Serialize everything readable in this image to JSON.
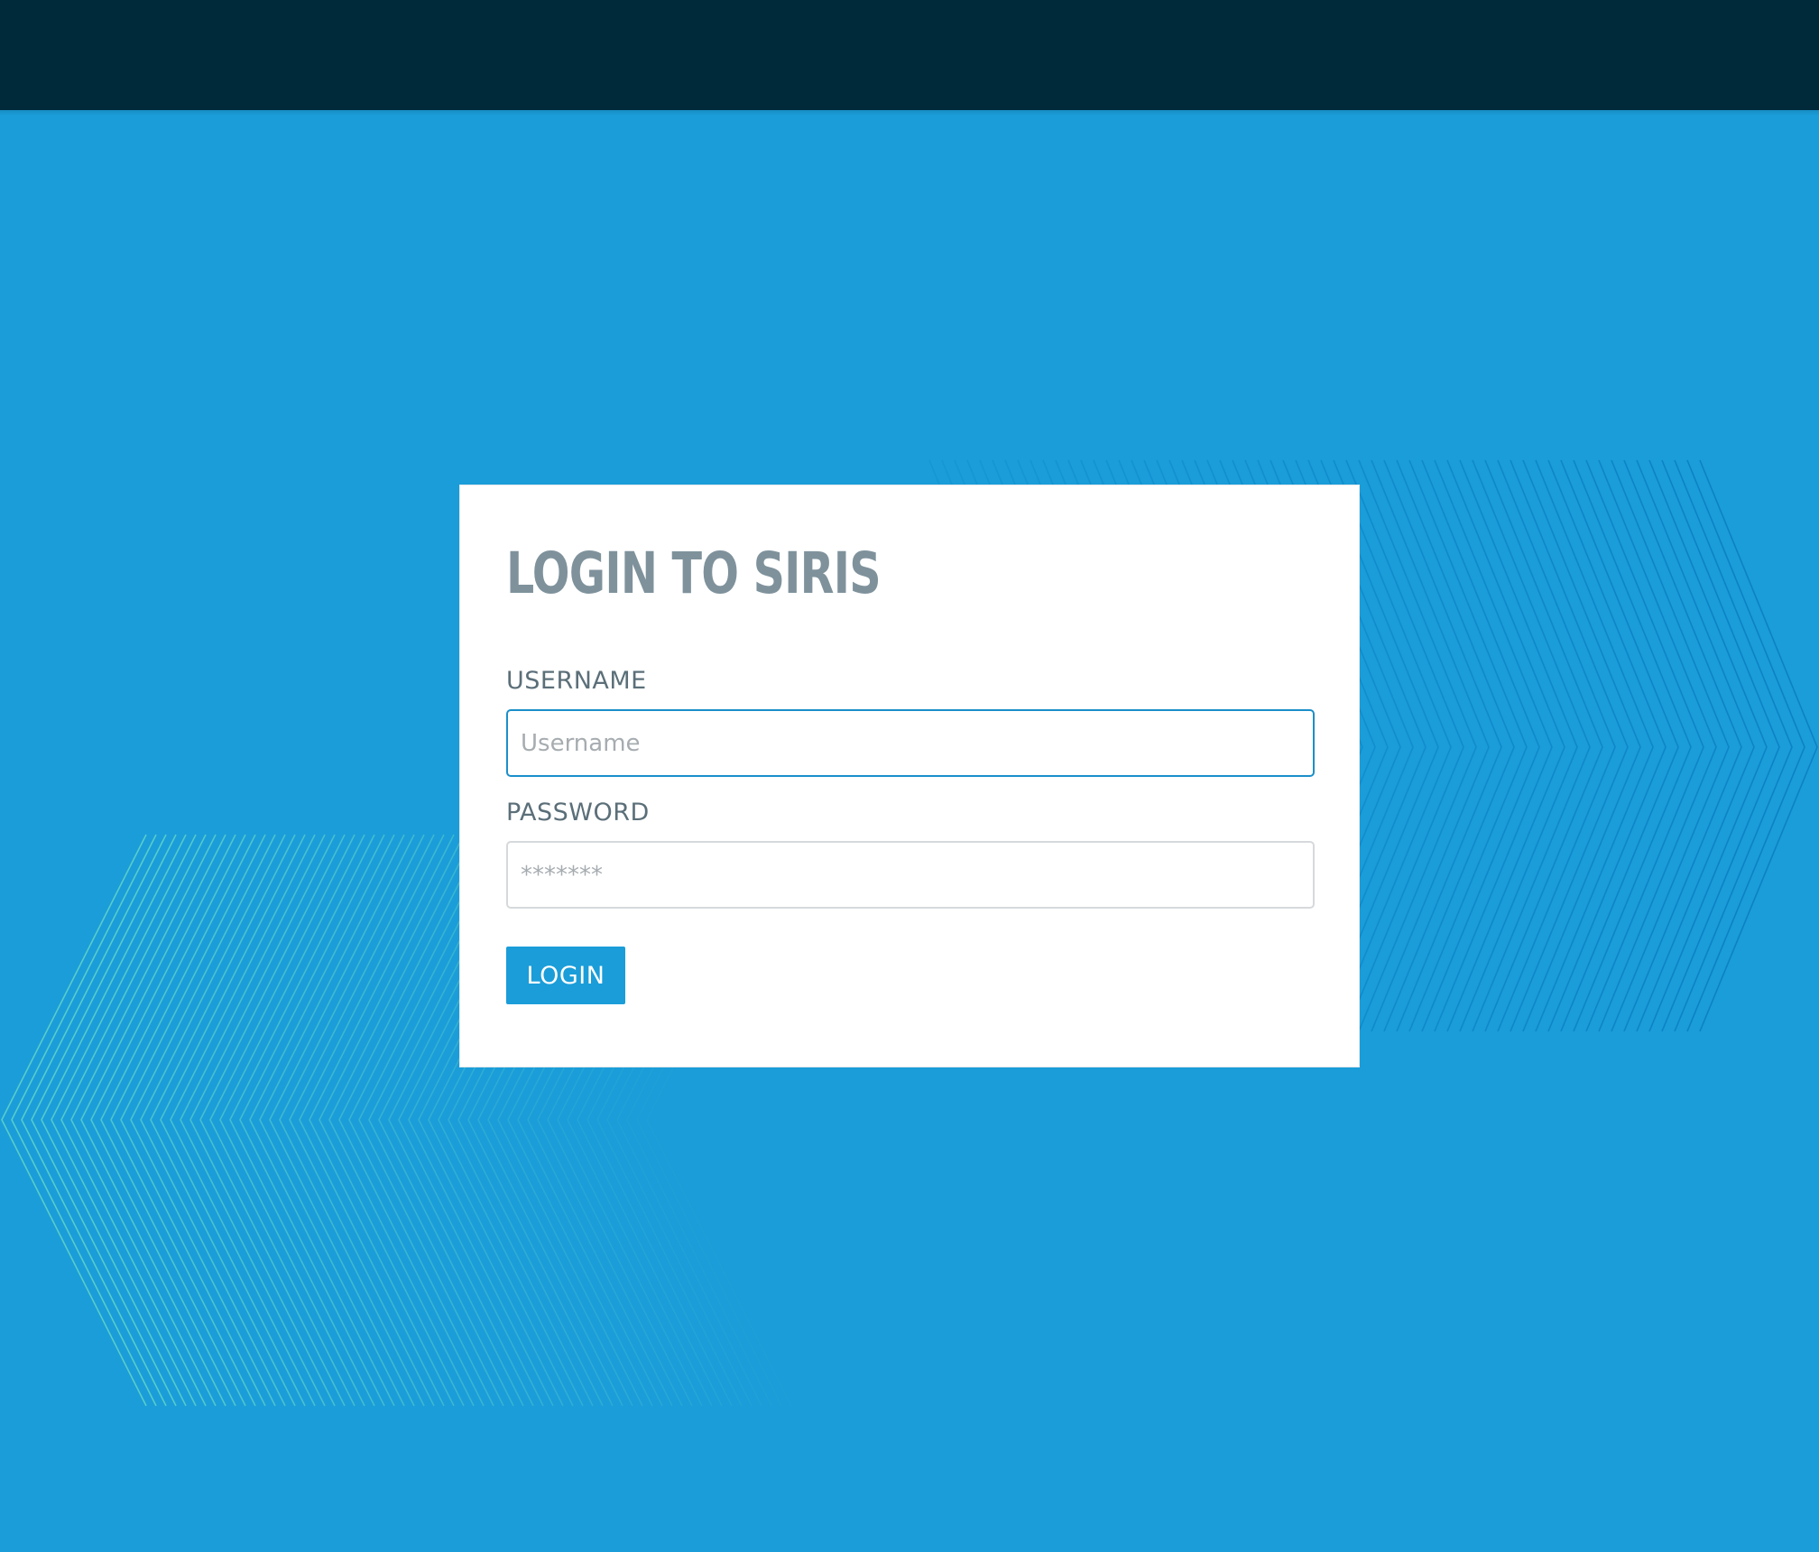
{
  "header": {
    "background_color": "#00293a"
  },
  "page": {
    "background_color": "#1a9dd9",
    "pattern_left_color": "#5fd3c8",
    "pattern_right_color": "#0a7cc0"
  },
  "login_form": {
    "title": "LOGIN TO SIRIS",
    "username_label": "USERNAME",
    "username_placeholder": "Username",
    "username_value": "",
    "password_label": "PASSWORD",
    "password_placeholder": "*******",
    "password_value": "",
    "submit_label": "LOGIN",
    "accent_color": "#1a9dd9",
    "title_color": "#7f929c"
  }
}
